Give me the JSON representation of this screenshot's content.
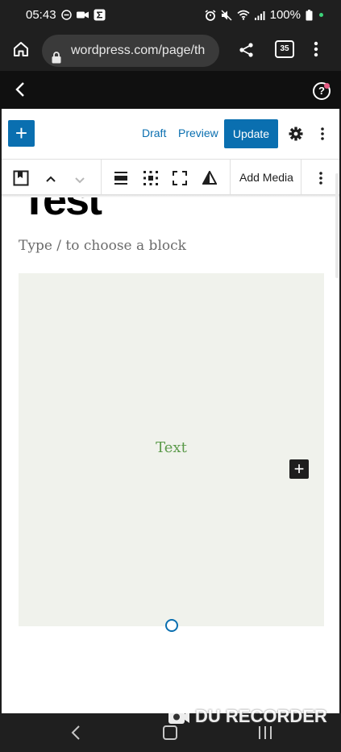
{
  "status_bar": {
    "time": "05:43",
    "battery": "100%"
  },
  "browser": {
    "url": "wordpress.com/page/th",
    "tab_count": "35"
  },
  "editor_header": {
    "add_block_label": "+",
    "draft_label": "Draft",
    "preview_label": "Preview",
    "update_label": "Update"
  },
  "block_toolbar": {
    "add_media_label": "Add Media"
  },
  "content": {
    "title": "Test",
    "block_placeholder": "Type / to choose a block",
    "cover_text": "Text",
    "inserter_label": "+"
  },
  "watermark": {
    "text": "DU RECORDER"
  },
  "colors": {
    "accent": "#0a6fb0",
    "cover_bg": "#f0f2ec",
    "cover_text": "#5b9a4a",
    "notification_dot": "#e45c84"
  }
}
